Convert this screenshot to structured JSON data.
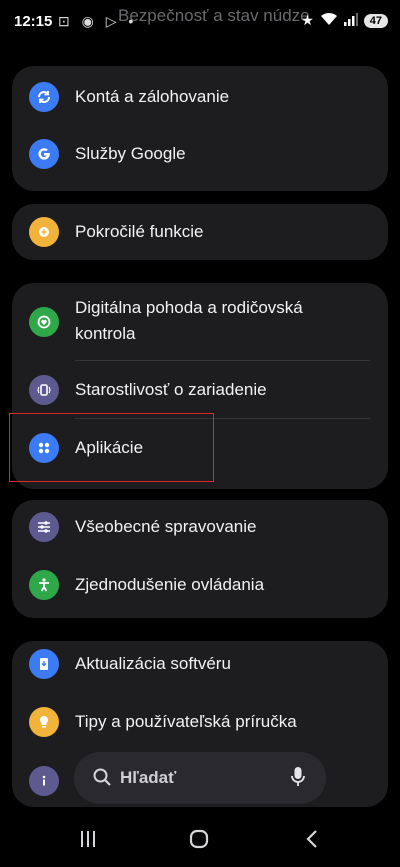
{
  "status_bar": {
    "time": "12:15",
    "left_icons": "⊡ ◉ ▷ •",
    "partial_heading": "Bezpečnosť a stav núdze",
    "battery": "47"
  },
  "groups": [
    {
      "items": [
        {
          "label": "Kontá a zálohovanie",
          "icon": "sync-icon",
          "color": "#3b7cf5"
        },
        {
          "label": "Služby Google",
          "icon": "google-icon",
          "color": "#3b7cf5"
        }
      ]
    },
    {
      "items": [
        {
          "label": "Pokročilé funkcie",
          "icon": "gear-plus-icon",
          "color": "#f2b33a"
        }
      ]
    },
    {
      "items": [
        {
          "label_line1": "Digitálna pohoda a rodičovská",
          "label_line2": "kontrola",
          "icon": "wellbeing-icon",
          "color": "#2fa84a"
        },
        {
          "label": "Starostlivosť o zariadenie",
          "icon": "device-care-icon",
          "color": "#5d5a8f"
        },
        {
          "label": "Aplikácie",
          "icon": "apps-icon",
          "color": "#3b7cf5"
        }
      ]
    },
    {
      "items": [
        {
          "label": "Všeobecné spravovanie",
          "icon": "sliders-icon",
          "color": "#5d5a8f"
        },
        {
          "label": "Zjednodušenie ovládania",
          "icon": "accessibility-icon",
          "color": "#2fa84a"
        }
      ]
    },
    {
      "items": [
        {
          "label": "Aktualizácia softvéru",
          "icon": "software-update-icon",
          "color": "#3b7cf5"
        },
        {
          "label": "Tipy a používateľská príručka",
          "icon": "bulb-icon",
          "color": "#f2b33a"
        },
        {
          "label": "",
          "icon": "info-icon",
          "color": "#5d5a8f"
        }
      ]
    }
  ],
  "search": {
    "placeholder": "Hľadať"
  },
  "nav": {
    "recents": "|||",
    "home": "○",
    "back": "‹"
  }
}
